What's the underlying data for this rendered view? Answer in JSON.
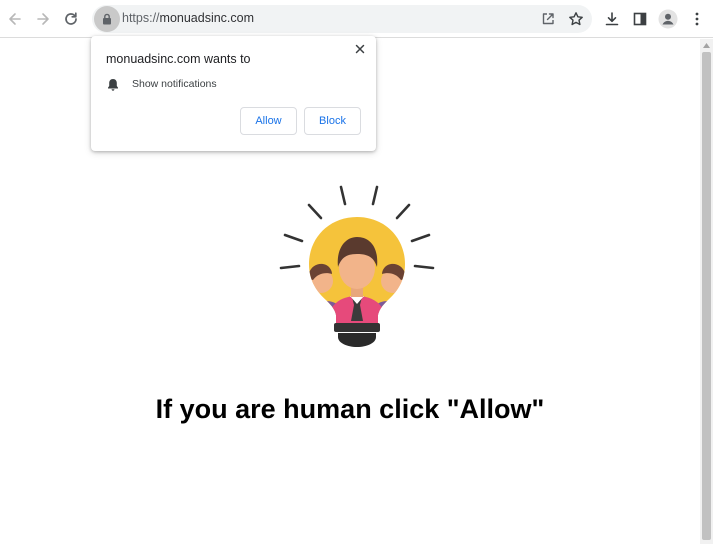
{
  "toolbar": {
    "back_icon": "arrow-left-icon",
    "forward_icon": "arrow-right-icon",
    "reload_icon": "reload-icon",
    "site_info_icon": "lock-icon",
    "url_scheme": "https://",
    "url_host": "monuadsinc.com",
    "share_icon": "share-icon",
    "bookmark_icon": "star-icon",
    "download_icon": "download-icon",
    "side_panel_icon": "side-panel-icon",
    "profile_icon": "avatar-icon",
    "menu_icon": "kebab-menu-icon"
  },
  "permission_prompt": {
    "title": "monuadsinc.com wants to",
    "permission_icon": "bell-icon",
    "permission_label": "Show notifications",
    "allow_label": "Allow",
    "block_label": "Block",
    "close_icon": "close-icon"
  },
  "page": {
    "illustration": "lightbulb-people-illustration",
    "headline": "If you are human click \"Allow\""
  },
  "colors": {
    "accent_blue": "#1a73e8",
    "bulb_yellow": "#f5c33b",
    "shirt_pink": "#e64a7b",
    "hair_brown": "#5a3a2e"
  }
}
